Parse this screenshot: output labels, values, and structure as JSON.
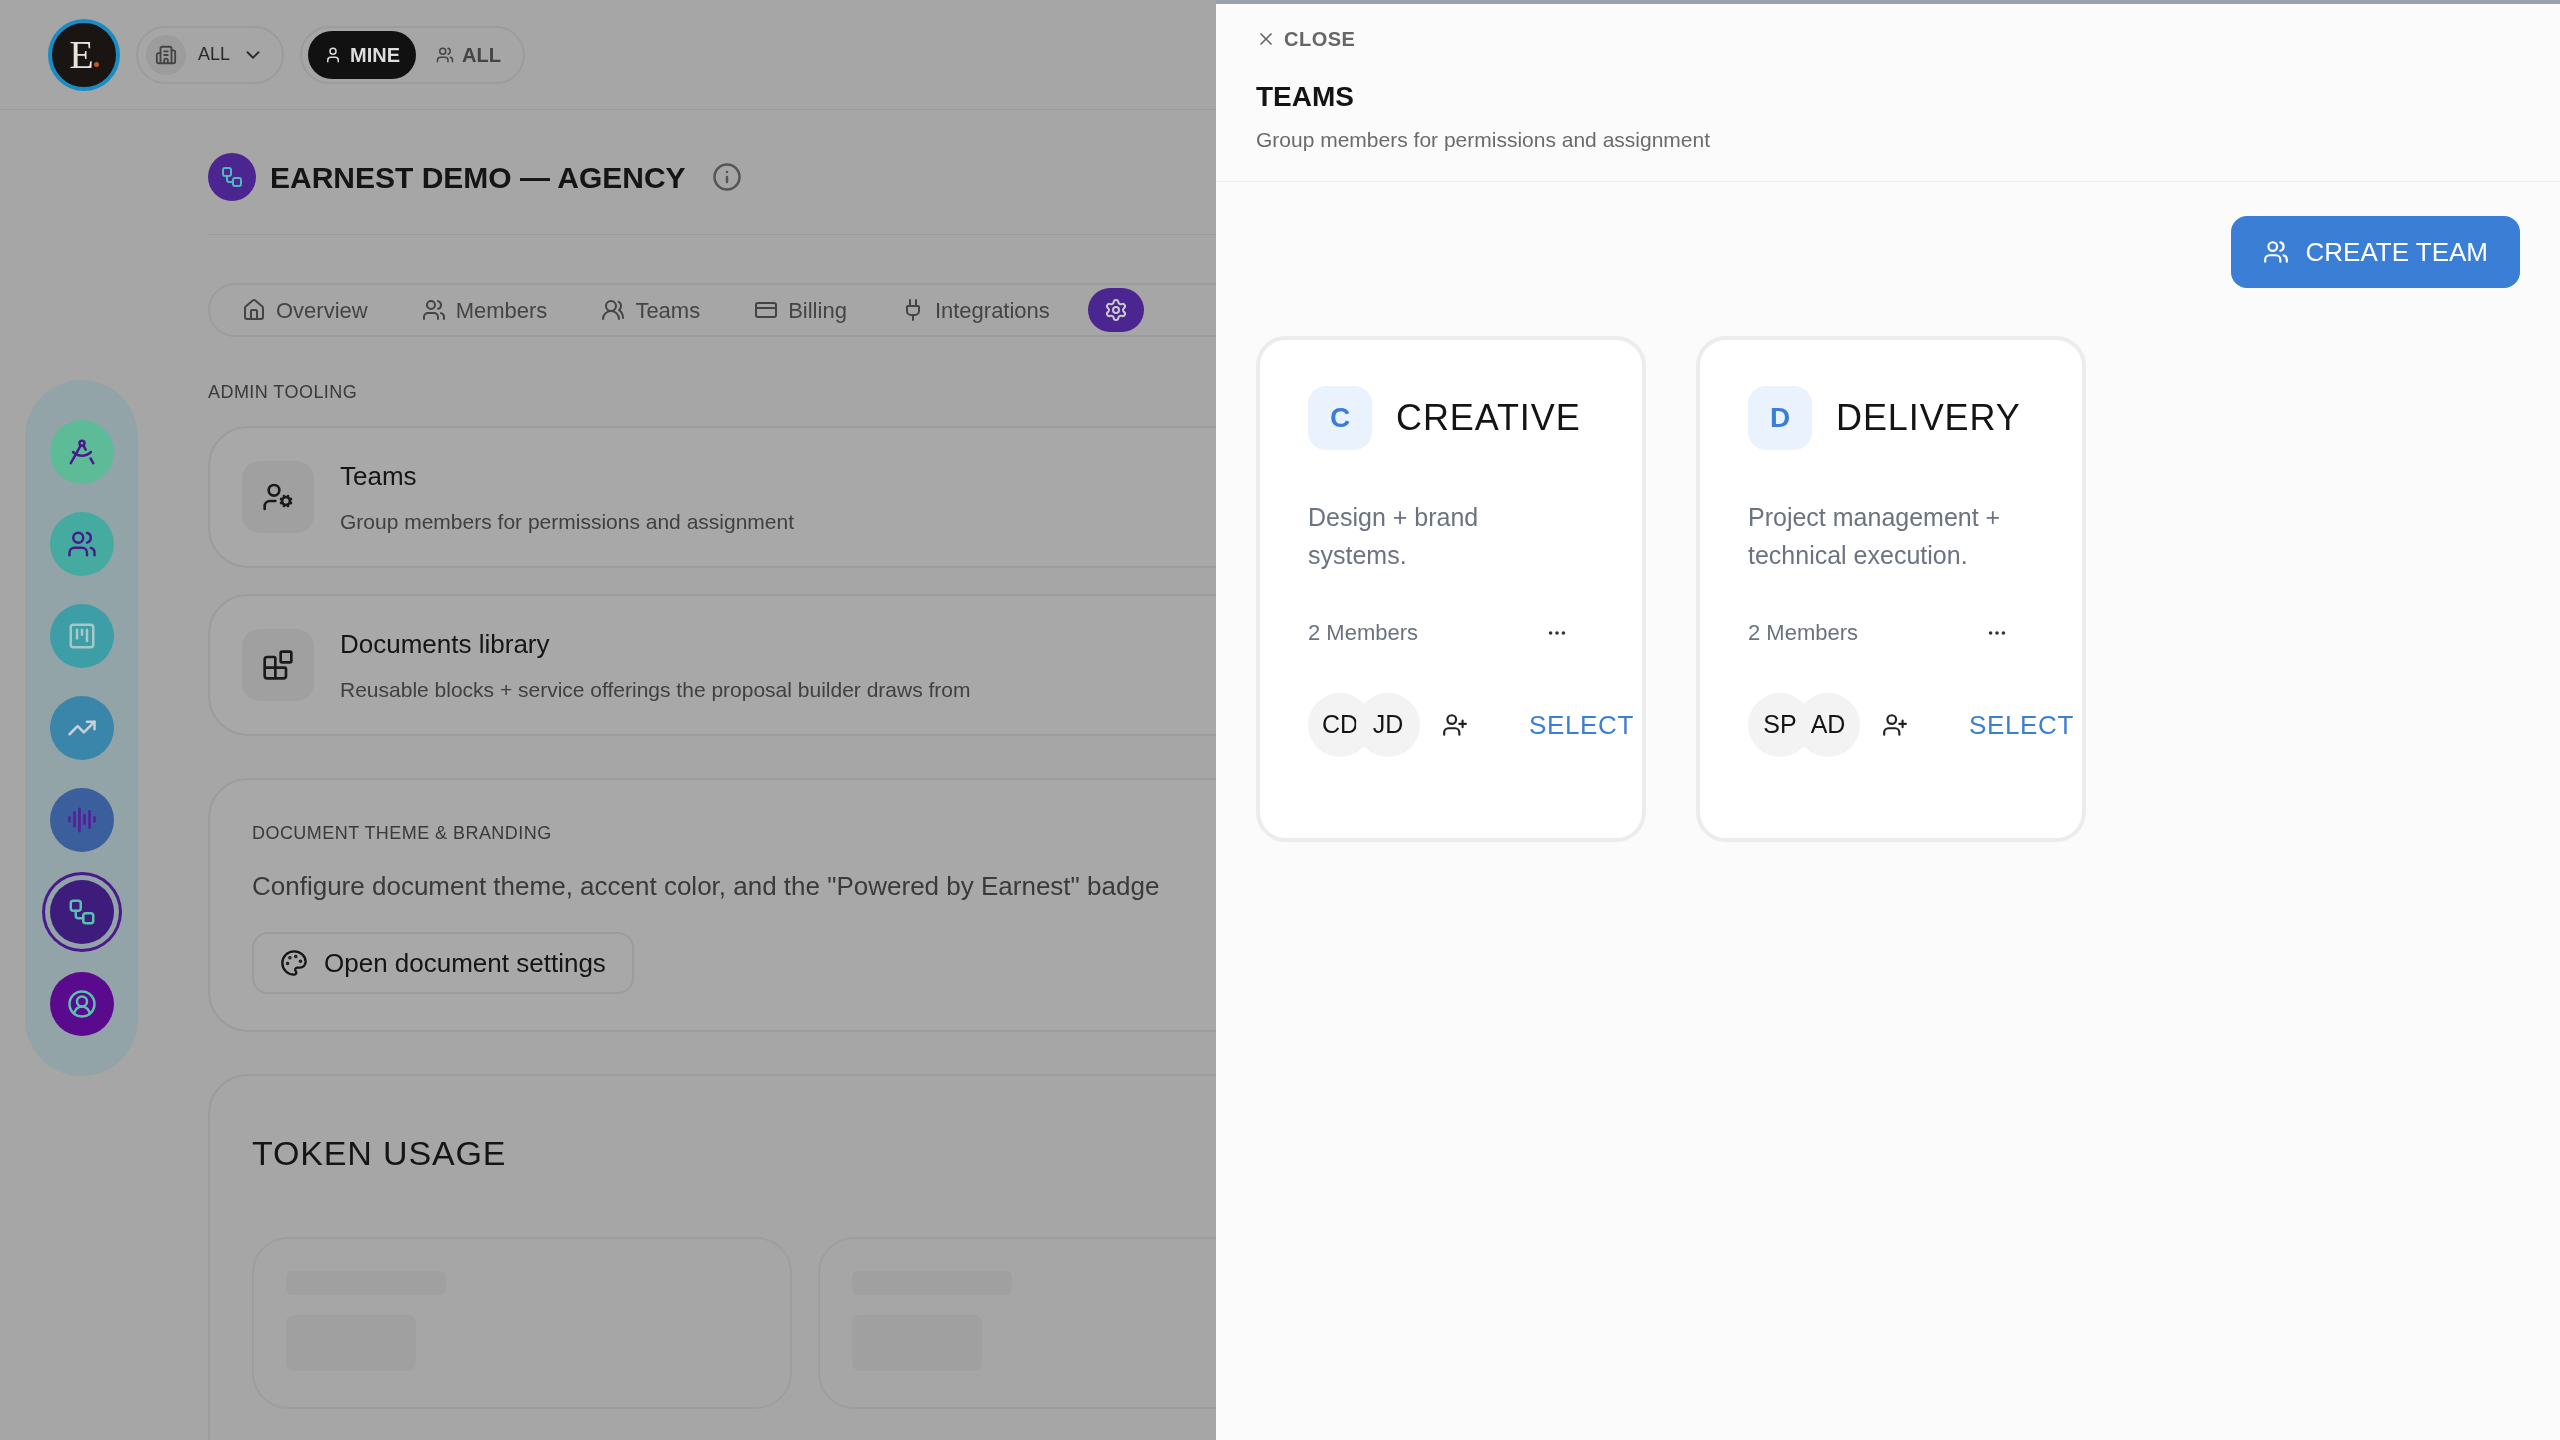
{
  "header": {
    "logo_letter": "E",
    "workspace_filter": "ALL",
    "scope": [
      {
        "label": "MINE",
        "kind": "mine",
        "selected": true
      },
      {
        "label": "ALL",
        "kind": "all",
        "selected": false
      }
    ]
  },
  "sidebar": {
    "items": [
      {
        "kind": "compass",
        "selected": false
      },
      {
        "kind": "team",
        "selected": false
      },
      {
        "kind": "board",
        "selected": false
      },
      {
        "kind": "trend",
        "selected": false
      },
      {
        "kind": "audio",
        "selected": false
      },
      {
        "kind": "network",
        "selected": true
      },
      {
        "kind": "profile",
        "selected": false
      }
    ]
  },
  "page": {
    "title": "EARNEST DEMO — AGENCY",
    "tabs": [
      {
        "kind": "overview",
        "label": "Overview",
        "selected": false
      },
      {
        "kind": "members",
        "label": "Members",
        "selected": false
      },
      {
        "kind": "teams",
        "label": "Teams",
        "selected": false
      },
      {
        "kind": "billing",
        "label": "Billing",
        "selected": false
      },
      {
        "kind": "integrations",
        "label": "Integrations",
        "selected": false
      },
      {
        "kind": "settings",
        "selected": true
      }
    ]
  },
  "admin_tooling": {
    "heading": "ADMIN TOOLING",
    "items": [
      {
        "kind": "teams",
        "title": "Teams",
        "description": "Group members for permissions and assignment"
      },
      {
        "kind": "library",
        "title": "Documents library",
        "description": "Reusable blocks + service offerings the proposal builder draws from"
      }
    ]
  },
  "branding": {
    "heading": "DOCUMENT THEME & BRANDING",
    "text": "Configure document theme, accent color, and the \"Powered by Earnest\" badge",
    "button": "Open document settings"
  },
  "token_usage": {
    "title": "TOKEN USAGE",
    "loading_cards": [
      {
        "kind": "skeleton"
      },
      {
        "kind": "skeleton"
      }
    ]
  },
  "drawer": {
    "close": "CLOSE",
    "title": "TEAMS",
    "subtitle": "Group members for permissions and assignment",
    "create_button": "CREATE TEAM",
    "teams": [
      {
        "initial": "C",
        "name": "CREATIVE",
        "description": "Design + brand systems.",
        "member_count": "2 Members",
        "members": [
          "CD",
          "JD"
        ],
        "select": "SELECT"
      },
      {
        "initial": "D",
        "name": "DELIVERY",
        "description": "Project management + technical execution.",
        "member_count": "2 Members",
        "members": [
          "SP",
          "AD"
        ],
        "select": "SELECT"
      }
    ]
  }
}
